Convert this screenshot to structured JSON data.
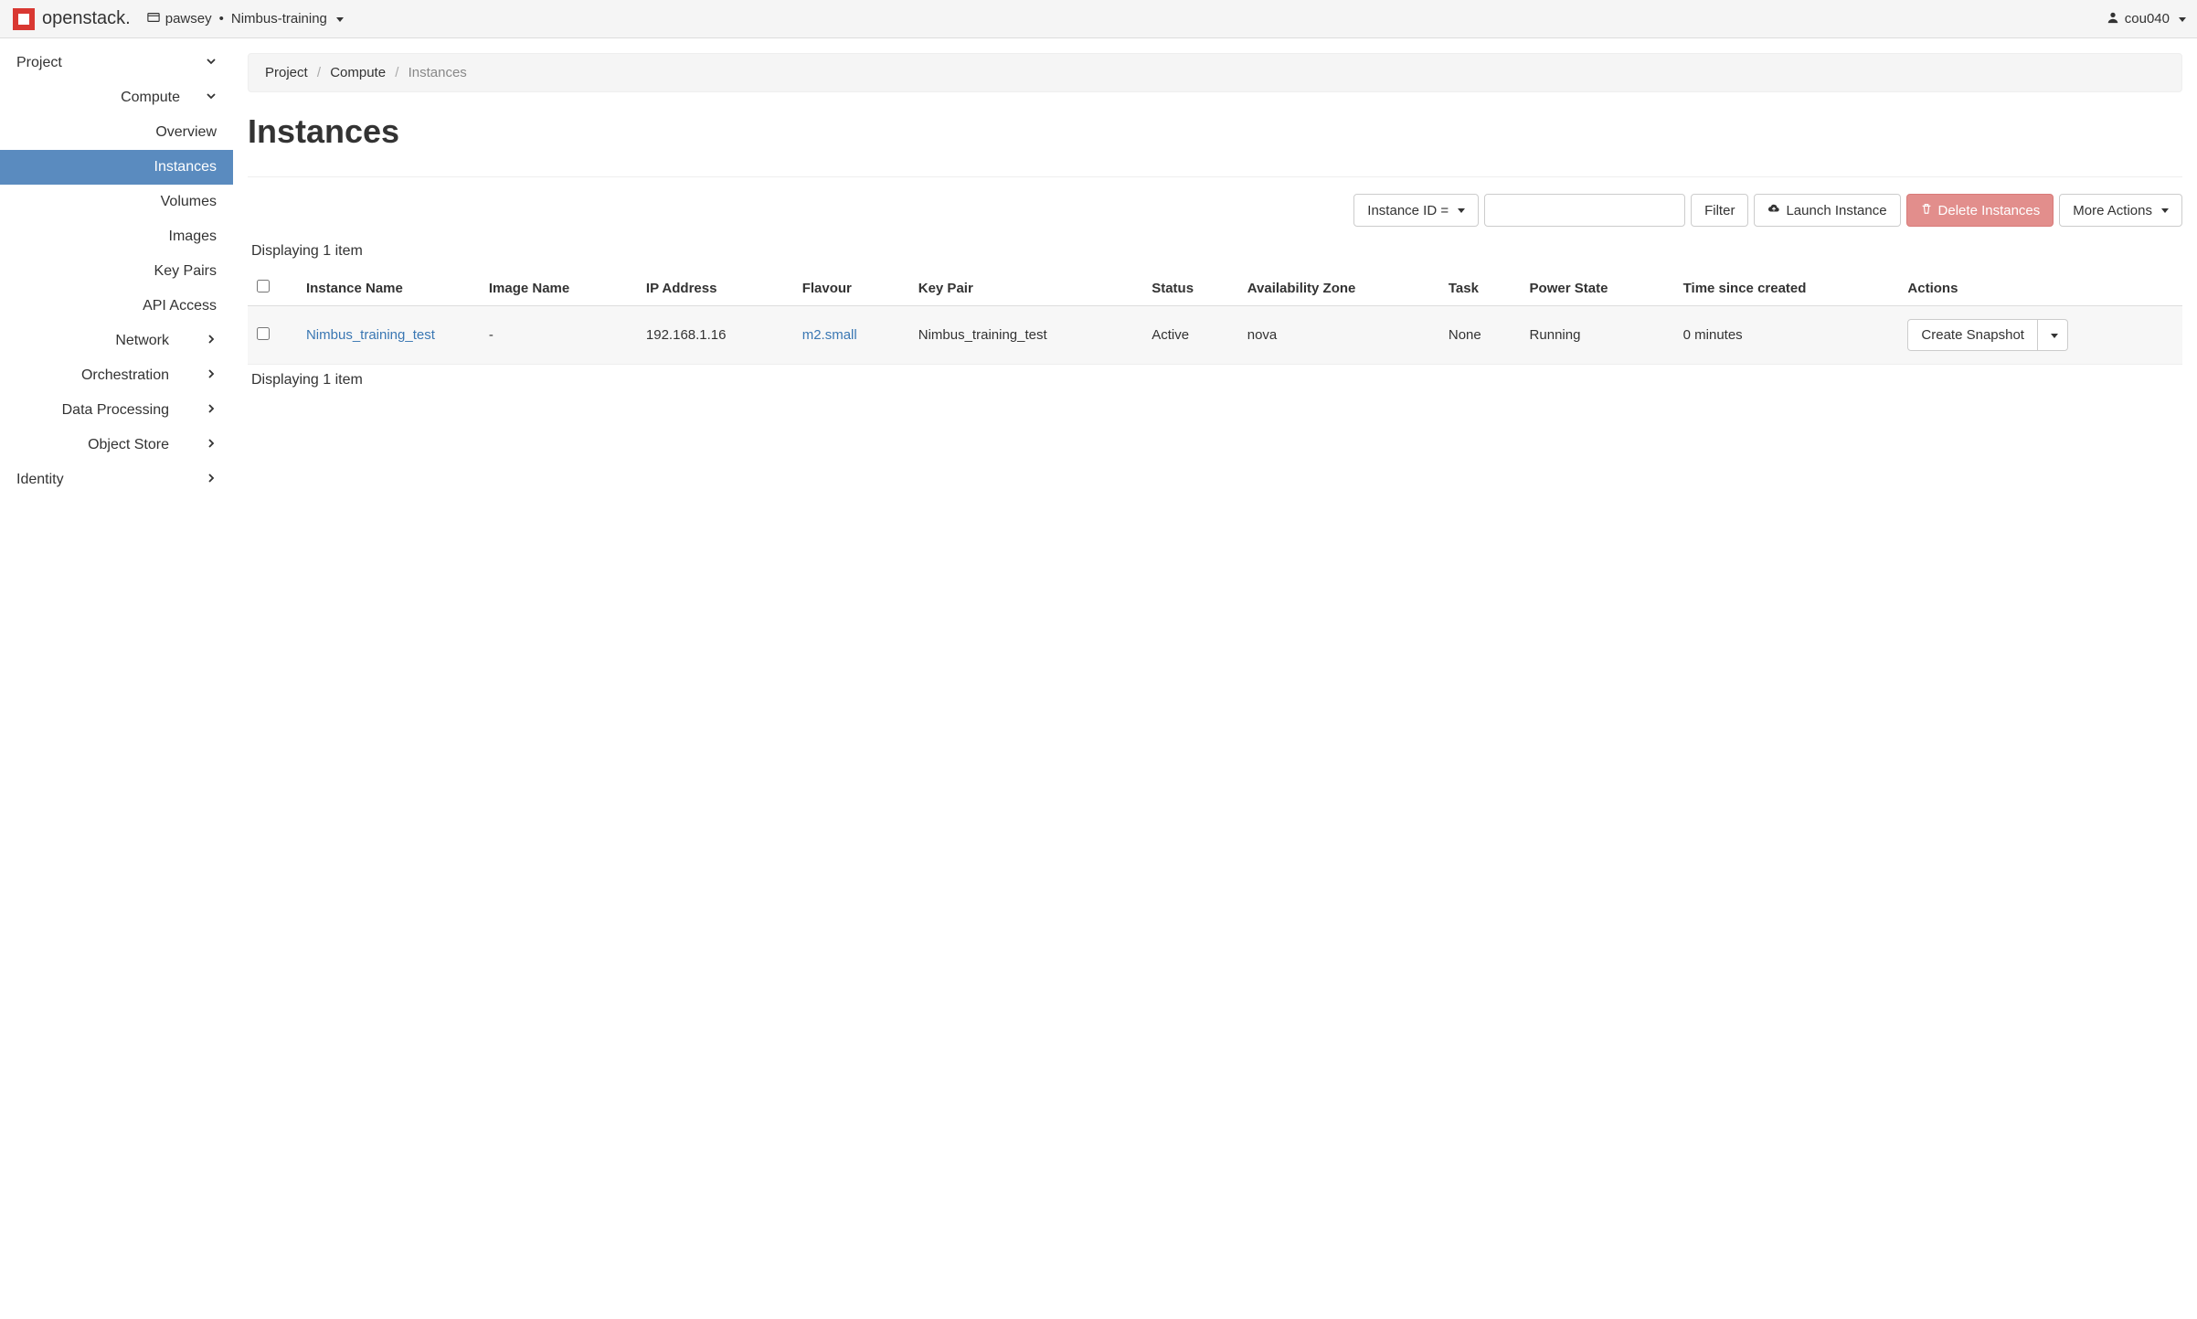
{
  "header": {
    "brand": "openstack.",
    "project_org": "pawsey",
    "project_name": "Nimbus-training",
    "user": "cou040"
  },
  "sidebar": {
    "project": "Project",
    "compute": "Compute",
    "compute_children": {
      "overview": "Overview",
      "instances": "Instances",
      "volumes": "Volumes",
      "images": "Images",
      "key_pairs": "Key Pairs",
      "api_access": "API Access"
    },
    "sections": {
      "network": "Network",
      "orchestration": "Orchestration",
      "data_processing": "Data Processing",
      "object_store": "Object Store"
    },
    "identity": "Identity"
  },
  "breadcrumb": {
    "project": "Project",
    "compute": "Compute",
    "instances": "Instances"
  },
  "page": {
    "title": "Instances",
    "displaying": "Displaying 1 item"
  },
  "actionbar": {
    "filter_field": "Instance ID =",
    "filter_btn": "Filter",
    "launch": "Launch Instance",
    "delete": "Delete Instances",
    "more": "More Actions"
  },
  "table": {
    "headers": {
      "instance_name": "Instance Name",
      "image_name": "Image Name",
      "ip_address": "IP Address",
      "flavour": "Flavour",
      "key_pair": "Key Pair",
      "status": "Status",
      "availability_zone": "Availability Zone",
      "task": "Task",
      "power_state": "Power State",
      "time_since_created": "Time since created",
      "actions": "Actions"
    },
    "row": {
      "instance_name": "Nimbus_training_test",
      "image_name": "-",
      "ip_address": "192.168.1.16",
      "flavour": "m2.small",
      "key_pair": "Nimbus_training_test",
      "status": "Active",
      "availability_zone": "nova",
      "task": "None",
      "power_state": "Running",
      "time_since_created": "0 minutes",
      "action_primary": "Create Snapshot"
    }
  }
}
